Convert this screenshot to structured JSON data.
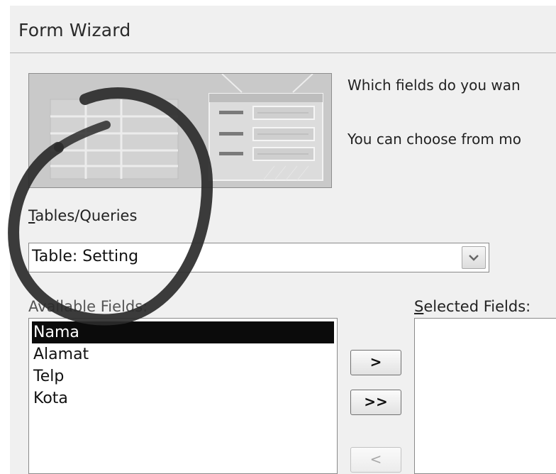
{
  "dialog": {
    "title": "Form Wizard",
    "instruction_line1": "Which fields do you wan",
    "instruction_line2": "You can choose from mo"
  },
  "tables_queries": {
    "label_prefix": "T",
    "label_rest": "ables/Queries",
    "selected": "Table: Setting",
    "dropdown_icon": "chevron-down-icon"
  },
  "available_fields": {
    "label": "Available Fields:",
    "items": [
      {
        "label": "Nama",
        "selected": true
      },
      {
        "label": "Alamat",
        "selected": false
      },
      {
        "label": "Telp",
        "selected": false
      },
      {
        "label": "Kota",
        "selected": false
      }
    ]
  },
  "selected_fields": {
    "label_prefix": "S",
    "label_rest": "elected Fields:",
    "items": []
  },
  "buttons": {
    "add_one": ">",
    "add_all": ">>",
    "remove_one": "<"
  },
  "colors": {
    "dialog_bg": "#f0f0f0",
    "selection_bg": "#0b0b0b",
    "annotation": "#2b2b2b"
  }
}
